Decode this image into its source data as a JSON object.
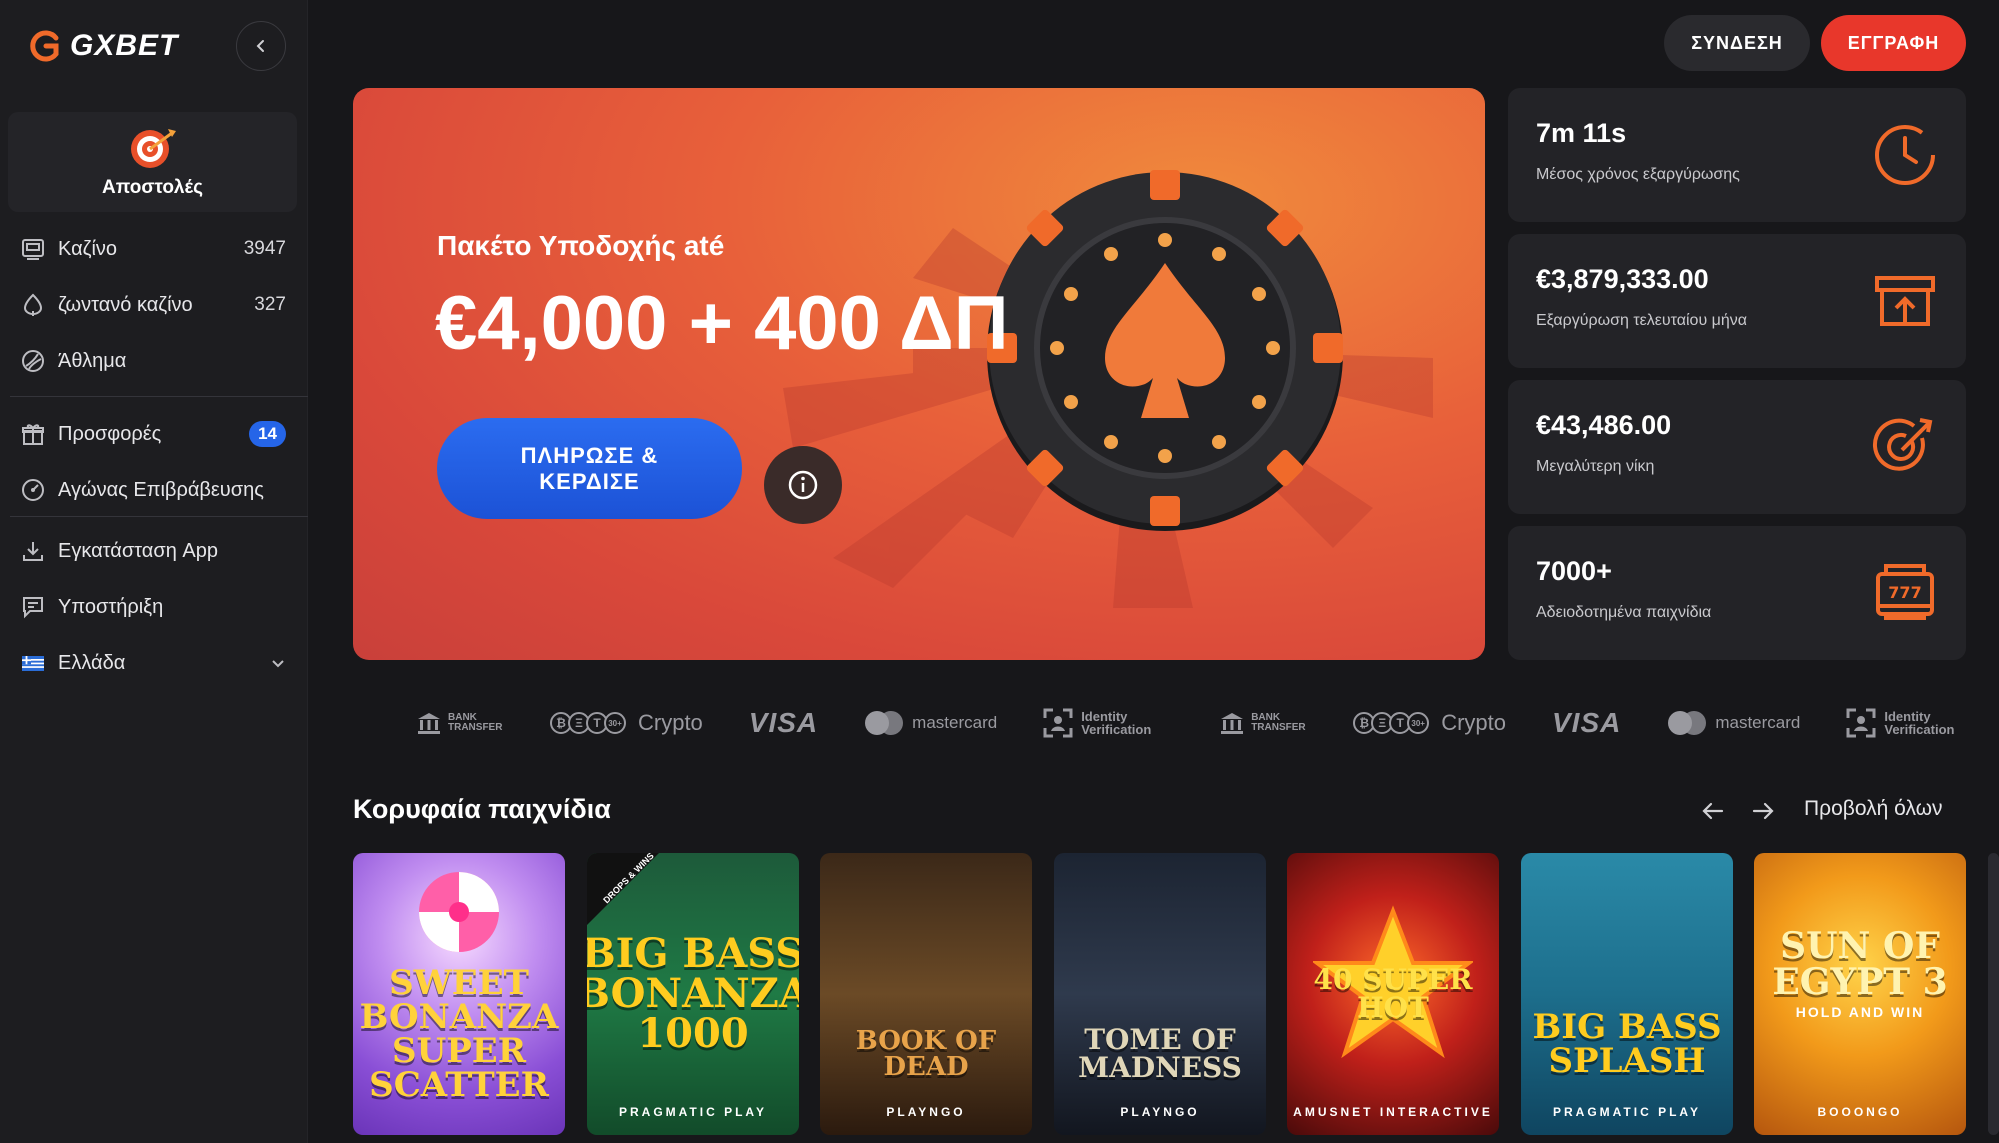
{
  "brand": {
    "name": "GXBET",
    "accent": "#e8372b",
    "primary_blue": "#2565e8"
  },
  "sidebar": {
    "missions_label": "Αποστολές",
    "items": [
      {
        "label": "Καζίνο",
        "count": "3947",
        "icon": "casino-icon"
      },
      {
        "label": "ζωντανό καζίνο",
        "count": "327",
        "icon": "live-casino-icon"
      },
      {
        "label": "Άθλημα",
        "count": "",
        "icon": "sport-icon"
      },
      {
        "label": "Προσφορές",
        "badge": "14",
        "icon": "gift-icon"
      },
      {
        "label": "Αγώνας Επιβράβευσης",
        "count": "",
        "icon": "gauge-icon"
      },
      {
        "label": "Εγκατάσταση App",
        "count": "",
        "icon": "download-icon"
      },
      {
        "label": "Υποστήριξη",
        "count": "",
        "icon": "chat-icon"
      },
      {
        "label": "Ελλάδα",
        "count": "",
        "icon": "greece-flag-icon"
      }
    ]
  },
  "header": {
    "login_label": "ΣΥΝΔΕΣΗ",
    "register_label": "ΕΓΓΡΑΦΗ"
  },
  "hero": {
    "subtitle": "Πακέτο Υποδοχής até",
    "title": "€4,000 + 400 ΔΠ",
    "cta_label": "ΠΛΗΡΩΣΕ & ΚΕΡΔΙΣΕ"
  },
  "stats": [
    {
      "value": "7m 11s",
      "label": "Μέσος χρόνος εξαργύρωσης",
      "icon": "clock-icon"
    },
    {
      "value": "€3,879,333.00",
      "label": "Εξαργύρωση τελευταίου μήνα",
      "icon": "withdraw-icon"
    },
    {
      "value": "€43,486.00",
      "label": "Μεγαλύτερη νίκη",
      "icon": "target-icon"
    },
    {
      "value": "7000+",
      "label": "Αδειοδοτημένα παιχνίδια",
      "icon": "slot-machine-icon"
    }
  ],
  "payments": {
    "bank": "BANK TRANSFER",
    "crypto": "Crypto",
    "visa": "VISA",
    "mastercard": "mastercard",
    "identity": "Identity Verification"
  },
  "top_games": {
    "title": "Κορυφαία παιχνίδια",
    "view_all": "Προβολή όλων",
    "games": [
      {
        "title": "SWEET BONANZA SUPER SCATTER",
        "provider": ""
      },
      {
        "title": "BIG BASS BONANZA 1000",
        "provider": "PRAGMATIC PLAY",
        "tag": "DROPS & WINS"
      },
      {
        "title": "BOOK OF DEAD",
        "provider": "PLAYNGO"
      },
      {
        "title": "TOME OF MADNESS",
        "provider": "PLAYNGO"
      },
      {
        "title": "40 SUPER HOT",
        "provider": "AMUSNET INTERACTIVE"
      },
      {
        "title": "BIG BASS SPLASH",
        "provider": "PRAGMATIC PLAY"
      },
      {
        "title": "SUN OF EGYPT 3",
        "subtitle": "HOLD AND WIN",
        "provider": "BOOONGO"
      }
    ]
  }
}
